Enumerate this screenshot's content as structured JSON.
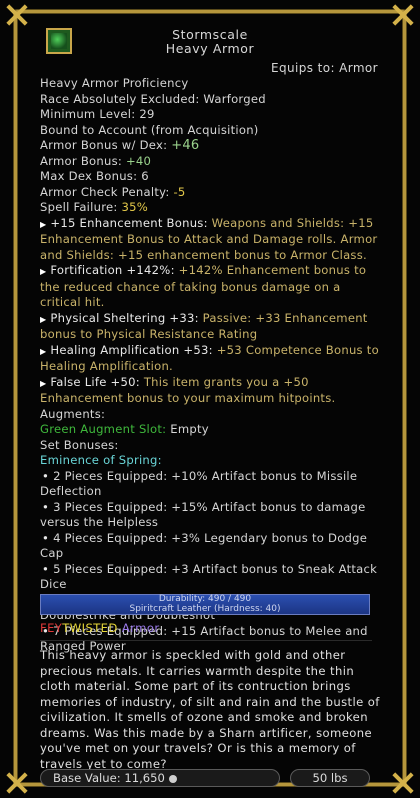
{
  "item": {
    "name": "Stormscale",
    "subtitle": "Heavy Armor",
    "equips_to": "Equips to:  Armor",
    "icon": "scale-armor-icon"
  },
  "requirements": [
    "Heavy Armor Proficiency",
    "Race Absolutely Excluded: Warforged",
    "Minimum Level: 29",
    "Bound to Account (from Acquisition)"
  ],
  "stats": {
    "armor_bonus_dex_label": "Armor Bonus w/ Dex: ",
    "armor_bonus_dex_value": "+46",
    "armor_bonus_label": "Armor Bonus: ",
    "armor_bonus_value": "+40",
    "max_dex_label": "Max Dex Bonus: ",
    "max_dex_value": "6",
    "acp_label": "Armor Check Penalty: ",
    "acp_value": "-5",
    "spell_failure_label": "Spell Failure: ",
    "spell_failure_value": "35%"
  },
  "effects": [
    {
      "name": "+15 Enhancement Bonus:",
      "desc": " Weapons and Shields: +15 Enhancement Bonus to Attack and Damage rolls. Armor and Shields: +15 enhancement bonus to Armor Class."
    },
    {
      "name": "Fortification +142%:",
      "desc": " +142% Enhancement bonus to the reduced chance of taking bonus damage on a critical hit."
    },
    {
      "name": "Physical Sheltering +33:",
      "desc": " Passive: +33 Enhancement bonus to Physical Resistance Rating"
    },
    {
      "name": "Healing Amplification +53:",
      "desc": " +53 Competence Bonus to Healing Amplification."
    },
    {
      "name": "False Life +50:",
      "desc": " This item grants you a +50 Enhancement bonus to your maximum hitpoints."
    }
  ],
  "augments": {
    "label": "Augments:",
    "slot_label": "Green Augment Slot:",
    "slot_value": " Empty"
  },
  "set": {
    "label": "Set Bonuses:",
    "name": "Eminence of Spring:",
    "pieces": [
      "2 Pieces Equipped: +10% Artifact bonus to Missile Deflection",
      "3 Pieces Equipped: +15% Artifact bonus to damage versus the Helpless",
      "4 Pieces Equipped: +3% Legendary bonus to Dodge Cap",
      "5 Pieces Equipped: +3 Artifact bonus to Sneak Attack Dice",
      "6 Pieces Equipped: +15% Artifact bonus to Doublestrike and Doubleshot",
      "7 Pieces Equipped: +15 Artifact bonus to Melee and Ranged Power"
    ]
  },
  "durability": {
    "line1": "Durability: 490 / 490",
    "line2": "Spiritcraft Leather (Hardness: 40)",
    "fraction": 1.0
  },
  "feytwisted": {
    "part1": "FEY",
    "part2": "TWISTED",
    "part3": " Armor"
  },
  "description": "This heavy armor is speckled with gold and other precious metals. It carries warmth despite the thin cloth material. Some part of its contruction brings memories of industry, of silt and rain and the bustle of civilization. It smells of ozone and smoke and broken dreams. Was this made by a Sharn artificer, someone you've met on your travels? Or is this a memory of travels yet to come?",
  "footer": {
    "base_value": "Base Value: 11,650",
    "weight": "50 lbs"
  },
  "colors": {
    "frame": "#b5963c",
    "effect_desc": "#c9b36a",
    "set_name": "#6ad6d8",
    "augment_slot": "#3fb83c",
    "fey": "#e23a3a",
    "twisted": "#e8d83a",
    "armor_purple": "#9a7ae8"
  }
}
